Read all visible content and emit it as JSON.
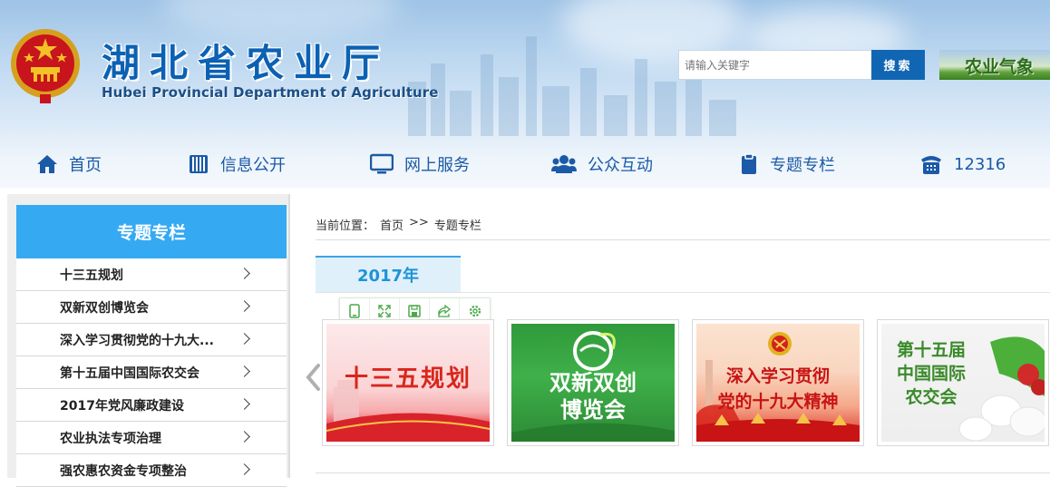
{
  "header": {
    "title_cn": "湖北省农业厅",
    "title_en": "Hubei Provincial Department of Agriculture",
    "search_placeholder": "请输入关键字",
    "search_button": "搜索",
    "weather_label": "农业气象"
  },
  "nav": [
    {
      "label": "首页",
      "icon": "home-icon"
    },
    {
      "label": "信息公开",
      "icon": "document-icon"
    },
    {
      "label": "网上服务",
      "icon": "monitor-icon"
    },
    {
      "label": "公众互动",
      "icon": "users-icon"
    },
    {
      "label": "专题专栏",
      "icon": "clipboard-icon"
    },
    {
      "label": "12316",
      "icon": "phone-icon"
    }
  ],
  "sidebar": {
    "title": "专题专栏",
    "items": [
      {
        "label": "十三五规划"
      },
      {
        "label": "双新双创博览会"
      },
      {
        "label": "深入学习贯彻党的十九大..."
      },
      {
        "label": "第十五届中国国际农交会"
      },
      {
        "label": "2017年党风廉政建设"
      },
      {
        "label": "农业执法专项治理"
      },
      {
        "label": "强农惠农资金专项整治"
      }
    ]
  },
  "breadcrumb": {
    "prefix": "当前位置：",
    "home": "首页",
    "separator": ">>",
    "current": "专题专栏"
  },
  "year_tab": "2017年",
  "toolbar": [
    "mobile-icon",
    "fullscreen-icon",
    "save-icon",
    "share-icon",
    "settings-icon"
  ],
  "cards": [
    {
      "caption": "十三五规划",
      "color": "#d9261c"
    },
    {
      "caption_line1": "双新双创",
      "caption_line2": "博览会",
      "color": "#ffffff"
    },
    {
      "caption_line1": "深入学习贯彻",
      "caption_line2": "党的十九大精神",
      "color": "#c81414"
    },
    {
      "caption_line1": "第十五届",
      "caption_line2": "中国国际",
      "caption_line3": "农交会",
      "color": "#3a8a2a"
    }
  ],
  "colors": {
    "brand_blue": "#0b61b3",
    "nav_blue": "#1b5aa6",
    "sidebar_header": "#35a9f2",
    "search_button": "#1166b4",
    "year_tab_text": "#1e93d8"
  }
}
